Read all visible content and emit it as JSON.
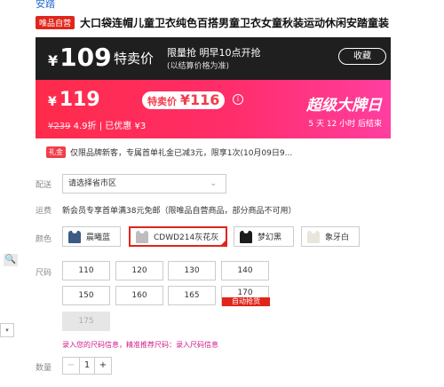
{
  "header": {
    "brand_link": "安踏",
    "self_badge": "唯品自营",
    "title": "大口袋连帽儿童卫衣纯色百搭男童卫衣女童秋装运动休闲安踏童装"
  },
  "banner_top": {
    "yen": "¥",
    "price": "109",
    "tag": "特卖价",
    "info_line1": "限量抢 明早10点开抢",
    "info_line2": "(以结算价格为准)",
    "remind_label": "收藏"
  },
  "banner_main": {
    "yen": "¥",
    "price": "119",
    "badge_prefix": "特卖价",
    "badge_price": "¥116",
    "info_icon": "i",
    "orig_price": "¥239",
    "discount": "4.9折",
    "saving": "已优惠 ¥3",
    "big_text": "超级大牌日",
    "countdown": "5 天 12 小时 后结束",
    "colors": {
      "start": "#ff2b4a",
      "end": "#ff3ea0"
    }
  },
  "notice": {
    "tag": "礼金",
    "text": "仅限品牌新客，专属首单礼金已减3元，限享1次(10月09日9..."
  },
  "delivery": {
    "label": "配送",
    "placeholder": "请选择省市区"
  },
  "shipping": {
    "label": "运费",
    "text": "新会员专享首单满38元免邮（限唯品自营商品，部分商品不可用）"
  },
  "colors_section": {
    "label": "颜色",
    "options": [
      {
        "name": "晨曦蓝",
        "swatch": "#3b5c82"
      },
      {
        "name": "CDWD214灰花灰",
        "swatch": "#bdbdbd",
        "selected": true
      },
      {
        "name": "梦幻黑",
        "swatch": "#1c1c1c"
      },
      {
        "name": "象牙白",
        "swatch": "#e9e6dd"
      }
    ]
  },
  "sizes_section": {
    "label": "尺码",
    "options": [
      "110",
      "120",
      "130",
      "140",
      "150",
      "160",
      "165",
      "170",
      "175"
    ],
    "auto_tag": "自动抢货",
    "disabled": [
      "175"
    ],
    "hint": "录入您的尺码信息，精准推荐尺码：录入尺码信息"
  },
  "quantity": {
    "label": "数量",
    "minus": "−",
    "value": "1",
    "plus": "+"
  },
  "side": {
    "zoom_icon": "🔍",
    "box_icon": "▾"
  }
}
